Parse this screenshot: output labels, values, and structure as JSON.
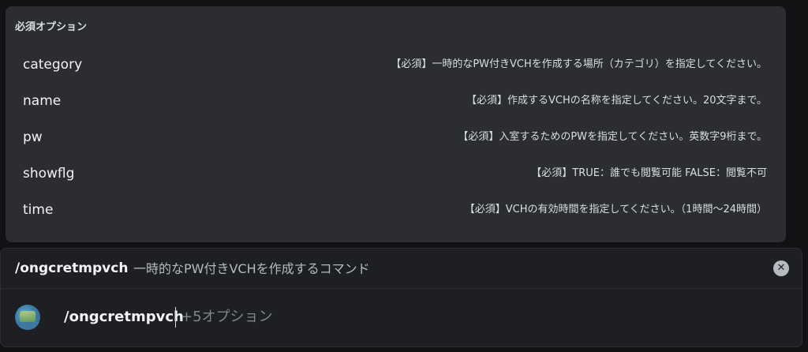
{
  "options_panel": {
    "heading": "必須オプション",
    "options": [
      {
        "name": "category",
        "description": "【必須】一時的なPW付きVCHを作成する場所（カテゴリ）を指定してください。"
      },
      {
        "name": "name",
        "description": "【必須】作成するVCHの名称を指定してください。20文字まで。"
      },
      {
        "name": "pw",
        "description": "【必須】入室するためのPWを指定してください。英数字9桁まで。"
      },
      {
        "name": "showflg",
        "description": "【必須】TRUE：誰でも閲覧可能 FALSE：閲覧不可"
      },
      {
        "name": "time",
        "description": "【必須】VCHの有効時間を指定してください。（1時間〜24時間）"
      }
    ]
  },
  "command_bar": {
    "command_name": "/ongcretmpvch",
    "command_description": "一時的なPW付きVCHを作成するコマンド",
    "clear_icon": "close-circle-icon",
    "input_command": "/ongcretmpvch",
    "input_hint": "+5オプション"
  }
}
